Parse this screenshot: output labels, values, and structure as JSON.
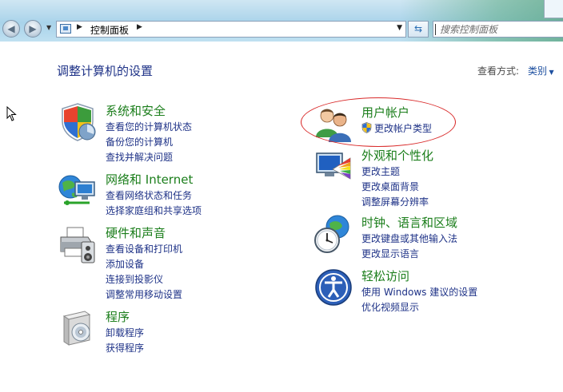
{
  "address_bar": {
    "breadcrumb": "控制面板"
  },
  "search": {
    "placeholder": "搜索控制面板"
  },
  "page": {
    "title": "调整计算机的设置",
    "view_by_label": "查看方式:",
    "view_by_value": "类别"
  },
  "categories_left": [
    {
      "heading": "系统和安全",
      "icon": "shield-icon",
      "links": [
        "查看您的计算机状态",
        "备份您的计算机",
        "查找并解决问题"
      ]
    },
    {
      "heading": "网络和 Internet",
      "icon": "network-globe-icon",
      "links": [
        "查看网络状态和任务",
        "选择家庭组和共享选项"
      ]
    },
    {
      "heading": "硬件和声音",
      "icon": "printer-speaker-icon",
      "links": [
        "查看设备和打印机",
        "添加设备",
        "连接到投影仪",
        "调整常用移动设置"
      ]
    },
    {
      "heading": "程序",
      "icon": "programs-icon",
      "links": [
        "卸载程序",
        "获得程序"
      ]
    }
  ],
  "categories_right": [
    {
      "heading": "用户帐户",
      "icon": "users-icon",
      "links": [
        "更改帐户类型"
      ]
    },
    {
      "heading": "外观和个性化",
      "icon": "appearance-icon",
      "links": [
        "更改主题",
        "更改桌面背景",
        "调整屏幕分辨率"
      ]
    },
    {
      "heading": "时钟、语言和区域",
      "icon": "clock-globe-icon",
      "links": [
        "更改键盘或其他输入法",
        "更改显示语言"
      ]
    },
    {
      "heading": "轻松访问",
      "icon": "ease-of-access-icon",
      "links": [
        "使用 Windows 建议的设置",
        "优化视频显示"
      ]
    }
  ],
  "colors": {
    "heading_green": "#1b7e1b",
    "link_blue": "#1e3287",
    "highlight_red": "#d92b2b"
  }
}
